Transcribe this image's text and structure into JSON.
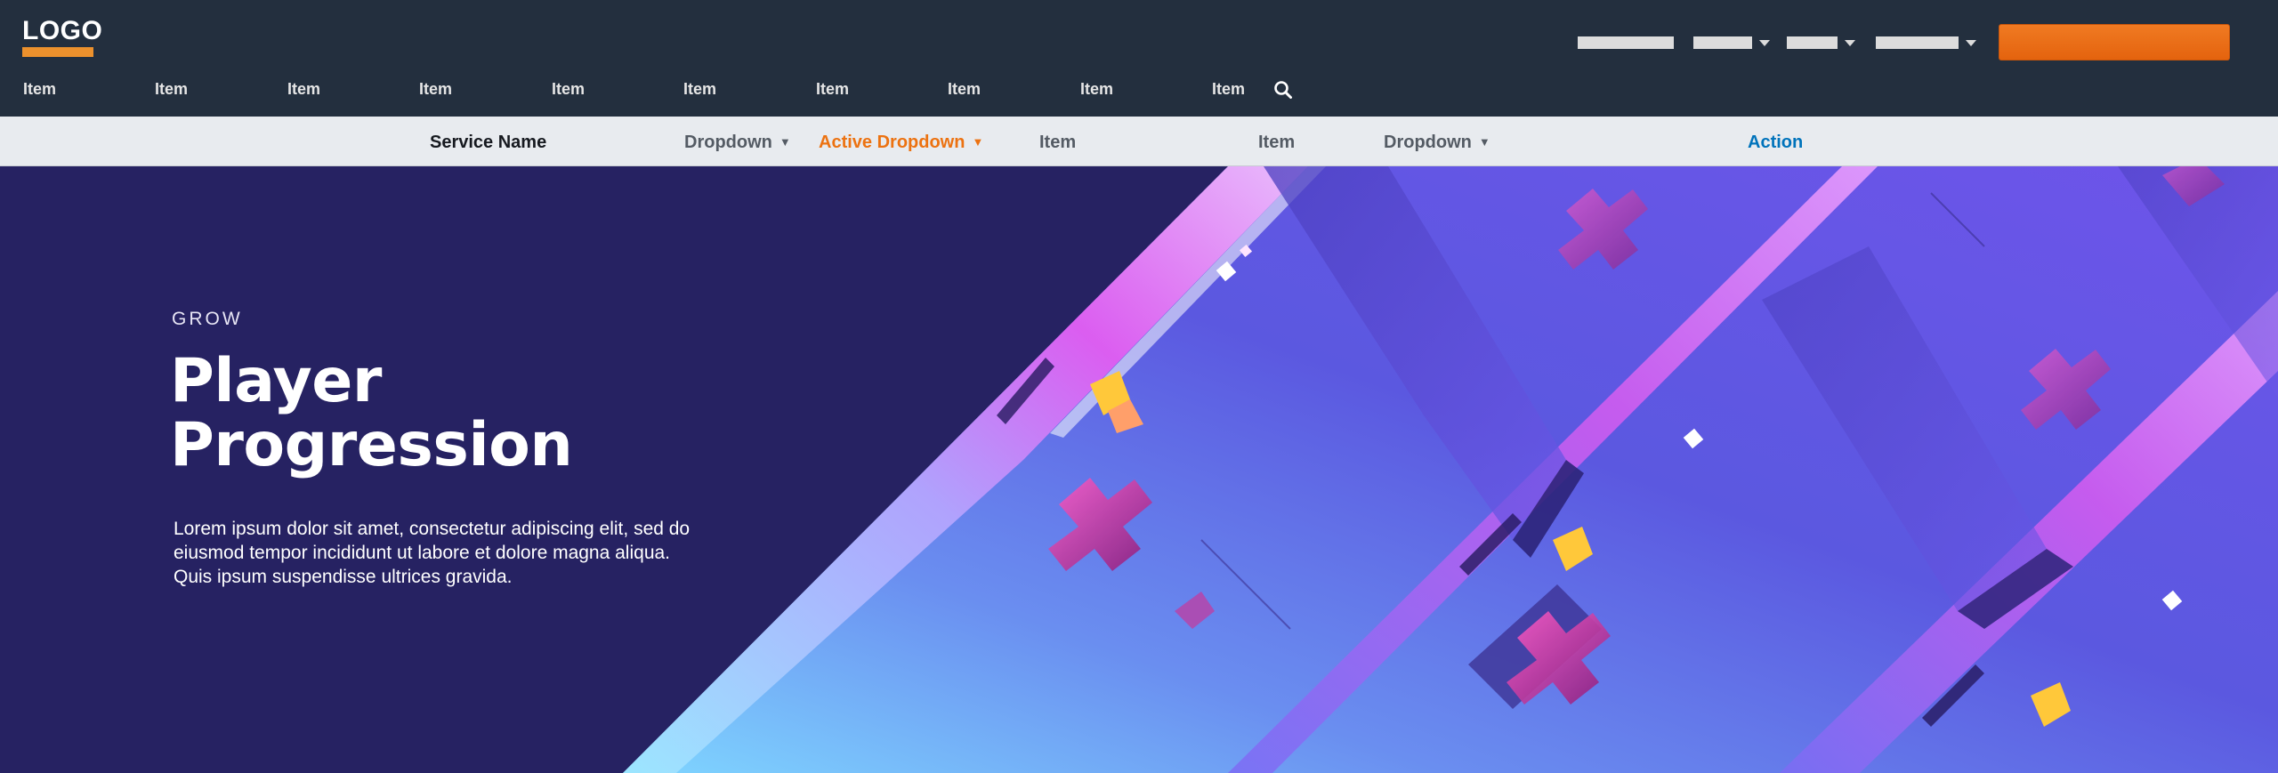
{
  "header": {
    "logo_text": "LOGO",
    "brand_color": "#ec912d",
    "cta_color": "#ec6a16",
    "utility_links": [
      {
        "has_dropdown": false
      },
      {
        "has_dropdown": true
      },
      {
        "has_dropdown": true
      },
      {
        "has_dropdown": true
      }
    ],
    "menu_items": [
      "Item",
      "Item",
      "Item",
      "Item",
      "Item",
      "Item",
      "Item",
      "Item",
      "Item",
      "Item"
    ],
    "search_icon": "search-icon"
  },
  "subnav": {
    "service_name": "Service Name",
    "items": [
      {
        "label": "Dropdown",
        "type": "dropdown"
      },
      {
        "label": "Active Dropdown",
        "type": "active-dropdown"
      },
      {
        "label": "Item",
        "type": "item"
      },
      {
        "label": "Item",
        "type": "item"
      },
      {
        "label": "Dropdown",
        "type": "dropdown"
      }
    ],
    "action_label": "Action",
    "active_color": "#ec7211",
    "action_color": "#0073bb"
  },
  "hero": {
    "eyebrow": "GROW",
    "title_line1": "Player",
    "title_line2": "Progression",
    "body_line1": "Lorem ipsum dolor sit amet, consectetur adipiscing elit, sed do",
    "body_line2": "eiusmod tempor incididunt ut labore et dolore magna aliqua.",
    "body_line3": "Quis ipsum suspendisse ultrices gravida.",
    "background_color": "#262262"
  }
}
